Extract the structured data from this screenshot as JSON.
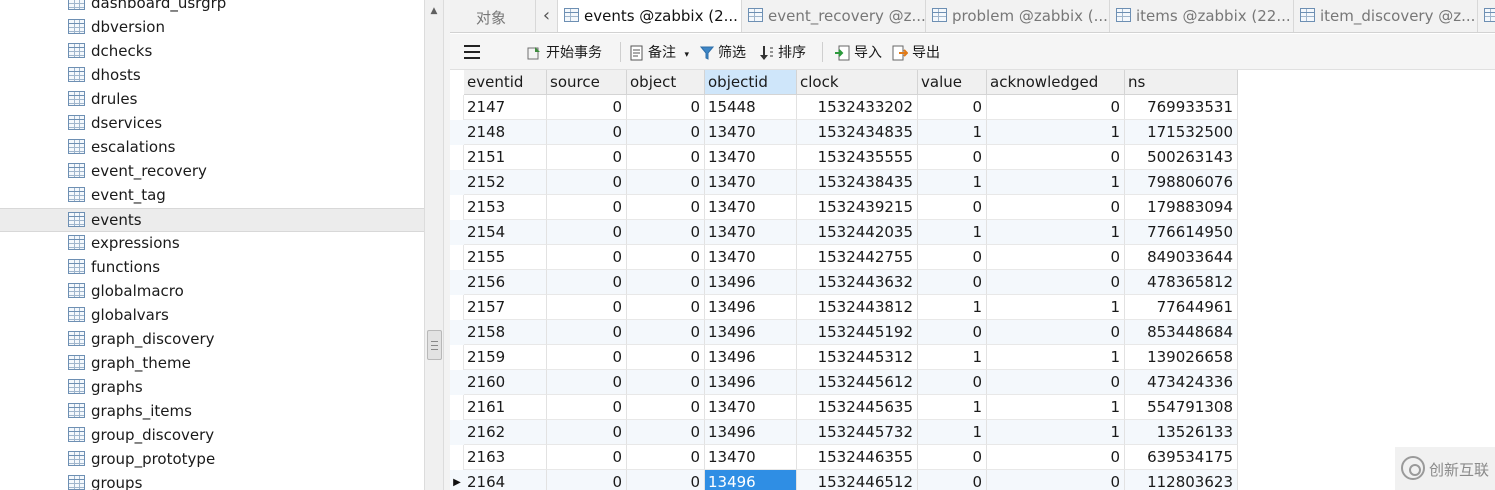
{
  "sidebar": {
    "items": [
      {
        "label": "dashboard_usrgrp"
      },
      {
        "label": "dbversion"
      },
      {
        "label": "dchecks"
      },
      {
        "label": "dhosts"
      },
      {
        "label": "drules"
      },
      {
        "label": "dservices"
      },
      {
        "label": "escalations"
      },
      {
        "label": "event_recovery"
      },
      {
        "label": "event_tag"
      },
      {
        "label": "events"
      },
      {
        "label": "expressions"
      },
      {
        "label": "functions"
      },
      {
        "label": "globalmacro"
      },
      {
        "label": "globalvars"
      },
      {
        "label": "graph_discovery"
      },
      {
        "label": "graph_theme"
      },
      {
        "label": "graphs"
      },
      {
        "label": "graphs_items"
      },
      {
        "label": "group_discovery"
      },
      {
        "label": "group_prototype"
      },
      {
        "label": "groups"
      }
    ],
    "selected": "events",
    "item_icon": "table-icon"
  },
  "tabs": [
    {
      "label": "对象"
    },
    {
      "label": "events @zabbix (2..."
    },
    {
      "label": "event_recovery @z..."
    },
    {
      "label": "problem @zabbix (..."
    },
    {
      "label": "items @zabbix (22..."
    },
    {
      "label": "item_discovery @z..."
    }
  ],
  "toolbar": {
    "begin_transaction": "开始事务",
    "note": "备注",
    "filter": "筛选",
    "sort": "排序",
    "import": "导入",
    "export": "导出"
  },
  "grid": {
    "columns": [
      "eventid",
      "source",
      "object",
      "objectid",
      "clock",
      "value",
      "acknowledged",
      "ns"
    ],
    "selected_column": "objectid",
    "rows": [
      [
        "2147",
        "0",
        "0",
        "15448",
        "1532433202",
        "0",
        "0",
        "769933531"
      ],
      [
        "2148",
        "0",
        "0",
        "13470",
        "1532434835",
        "1",
        "1",
        "171532500"
      ],
      [
        "2151",
        "0",
        "0",
        "13470",
        "1532435555",
        "0",
        "0",
        "500263143"
      ],
      [
        "2152",
        "0",
        "0",
        "13470",
        "1532438435",
        "1",
        "1",
        "798806076"
      ],
      [
        "2153",
        "0",
        "0",
        "13470",
        "1532439215",
        "0",
        "0",
        "179883094"
      ],
      [
        "2154",
        "0",
        "0",
        "13470",
        "1532442035",
        "1",
        "1",
        "776614950"
      ],
      [
        "2155",
        "0",
        "0",
        "13470",
        "1532442755",
        "0",
        "0",
        "849033644"
      ],
      [
        "2156",
        "0",
        "0",
        "13496",
        "1532443632",
        "0",
        "0",
        "478365812"
      ],
      [
        "2157",
        "0",
        "0",
        "13496",
        "1532443812",
        "1",
        "1",
        "77644961"
      ],
      [
        "2158",
        "0",
        "0",
        "13496",
        "1532445192",
        "0",
        "0",
        "853448684"
      ],
      [
        "2159",
        "0",
        "0",
        "13496",
        "1532445312",
        "1",
        "1",
        "139026658"
      ],
      [
        "2160",
        "0",
        "0",
        "13496",
        "1532445612",
        "0",
        "0",
        "473424336"
      ],
      [
        "2161",
        "0",
        "0",
        "13470",
        "1532445635",
        "1",
        "1",
        "554791308"
      ],
      [
        "2162",
        "0",
        "0",
        "13496",
        "1532445732",
        "1",
        "1",
        "13526133"
      ],
      [
        "2163",
        "0",
        "0",
        "13470",
        "1532446355",
        "0",
        "0",
        "639534175"
      ],
      [
        "2164",
        "0",
        "0",
        "13496",
        "1532446512",
        "0",
        "0",
        "112803623"
      ]
    ],
    "current_row_index": 15,
    "current_row_marker": "▶"
  },
  "watermark": {
    "text": "创新互联"
  },
  "colors": {
    "selection": "#2f8ee4",
    "header_selected": "#cfe6fa",
    "alt_row": "#f4f8fc"
  }
}
